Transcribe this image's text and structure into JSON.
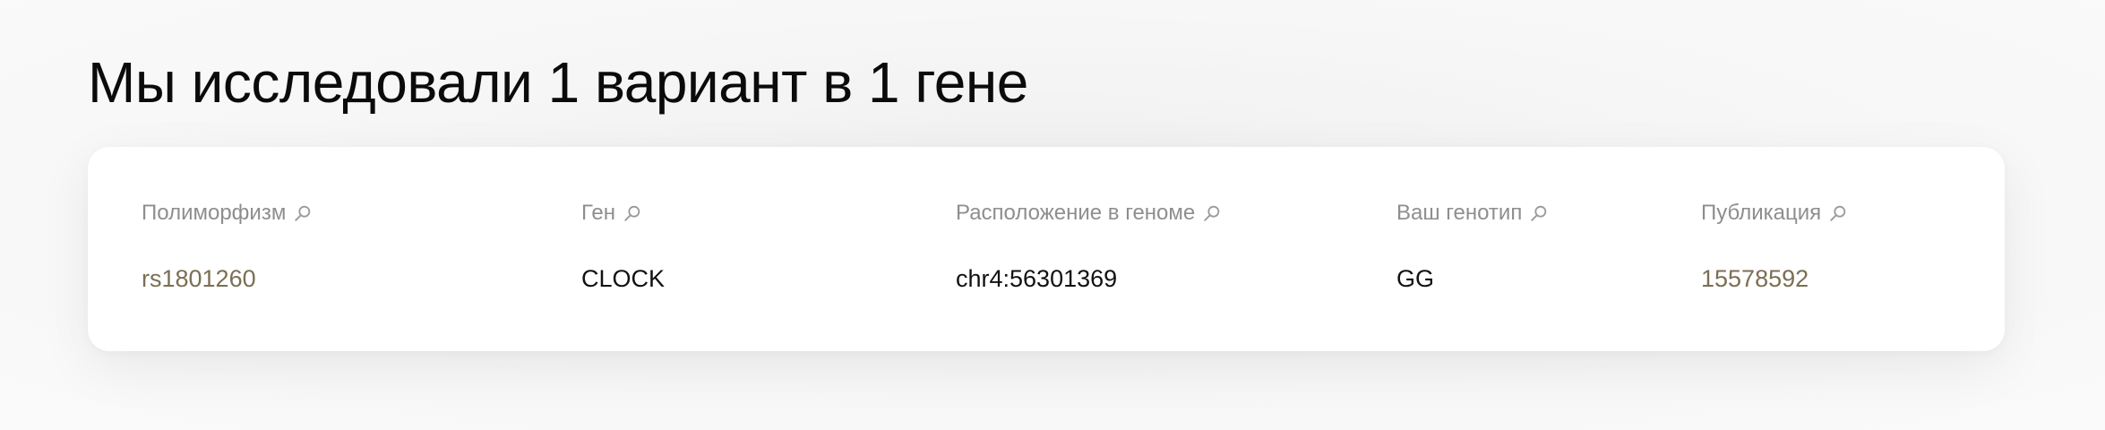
{
  "page": {
    "title": "Мы исследовали 1 вариант в 1 гене"
  },
  "table": {
    "columns": [
      {
        "label": "Полиморфизм",
        "icon": "search-icon"
      },
      {
        "label": "Ген",
        "icon": "search-icon"
      },
      {
        "label": "Расположение в геноме",
        "icon": "search-icon"
      },
      {
        "label": "Ваш генотип",
        "icon": "search-icon"
      },
      {
        "label": "Публикация",
        "icon": "search-icon"
      }
    ],
    "rows": [
      {
        "polymorphism": "rs1801260",
        "gene": "CLOCK",
        "location": "chr4:56301369",
        "genotype": "GG",
        "publication": "15578592"
      }
    ]
  },
  "colors": {
    "link": "#7b6e53",
    "header_text": "#8e8e8e",
    "body_text": "#111111"
  }
}
